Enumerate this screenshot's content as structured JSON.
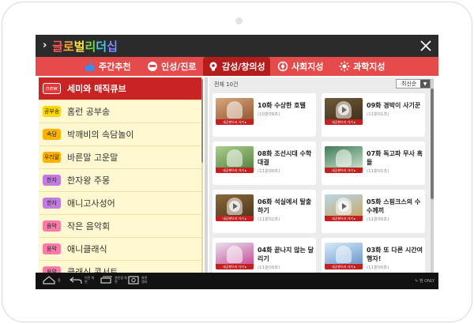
{
  "app": {
    "title_chars": [
      {
        "ch": "글",
        "color": "#ff5a5a"
      },
      {
        "ch": "로",
        "color": "#ffa53a"
      },
      {
        "ch": "벌",
        "color": "#ffe14a"
      },
      {
        "ch": "리",
        "color": "#7ad94a"
      },
      {
        "ch": "더",
        "color": "#4ac6e8"
      },
      {
        "ch": "십",
        "color": "#7a8cff"
      }
    ],
    "title": "글로벌리더십"
  },
  "tabs": [
    {
      "label": "주간추천",
      "icon": "thumbs-up-icon",
      "active": false
    },
    {
      "label": "인성/진로",
      "icon": "emoji-face-icon",
      "active": false
    },
    {
      "label": "감성/창의성",
      "icon": "lightbulb-icon",
      "active": true
    },
    {
      "label": "사회지성",
      "icon": "globe-icon",
      "active": false
    },
    {
      "label": "과학지성",
      "icon": "atom-icon",
      "active": false
    }
  ],
  "categories": [
    {
      "badge": "new",
      "badge_color": "#e23a3a",
      "label": "세미와 매직큐브",
      "active": true
    },
    {
      "badge": "공부송",
      "badge_color": "#ffd800",
      "label": "홈런 공부송",
      "active": false
    },
    {
      "badge": "속담",
      "badge_color": "#ffb300",
      "label": "박깨비의 속담놀이",
      "active": false
    },
    {
      "badge": "우리말",
      "badge_color": "#ffb300",
      "label": "바른말 고운말",
      "active": false
    },
    {
      "badge": "한자",
      "badge_color": "#c27be0",
      "label": "한자왕 주몽",
      "active": false
    },
    {
      "badge": "한자",
      "badge_color": "#c27be0",
      "label": "애니고사성어",
      "active": false
    },
    {
      "badge": "음악",
      "badge_color": "#ff7aa8",
      "label": "작은 음악회",
      "active": false
    },
    {
      "badge": "음악",
      "badge_color": "#ff7aa8",
      "label": "애니클래식",
      "active": false
    },
    {
      "badge": "음악",
      "badge_color": "#ff7aa8",
      "label": "클래식 콘서트",
      "active": false
    }
  ],
  "list": {
    "count_label": "전체 10건",
    "sort_label": "최신순",
    "thumb_tag": "내공쌓으러 가기 ▸",
    "episodes": [
      {
        "title": "10화 수상한 호텔",
        "duration": "(10분09초)",
        "thumb_bg": "#d9a77a",
        "thumb_fg": "#8a4b2a",
        "play": false
      },
      {
        "title": "09화 경박이 사기꾼",
        "duration": "(11분01초)",
        "thumb_bg": "#6f5a3a",
        "thumb_fg": "#3a2a18",
        "play": true
      },
      {
        "title": "08화 조선시대 수학 대결",
        "duration": "(11분00초)",
        "thumb_bg": "#a9d08a",
        "thumb_fg": "#4d7a3a",
        "play": false
      },
      {
        "title": "07화 독고파 무사 혹 돌",
        "duration": "(11분01초)",
        "thumb_bg": "#3f7a55",
        "thumb_fg": "#d8f0d8",
        "play": false
      },
      {
        "title": "06화 석실에서 탈출하기",
        "duration": "(11분02초)",
        "thumb_bg": "#8a6a3a",
        "thumb_fg": "#4a3218",
        "play": true
      },
      {
        "title": "05화 스핑크스의 수수께끼",
        "duration": "(11분00초)",
        "thumb_bg": "#b8d8e8",
        "thumb_fg": "#c9a25a",
        "play": true
      },
      {
        "title": "04화 끝나지 않는 달리기",
        "duration": "(11분00초)",
        "thumb_bg": "#e8e0f0",
        "thumb_fg": "#c63a8a",
        "play": false
      },
      {
        "title": "03화 또 다른 시간여행자!",
        "duration": "(11분00초)",
        "thumb_bg": "#d8ecf8",
        "thumb_fg": "#5a8ac8",
        "play": false
      }
    ]
  },
  "navbar": {
    "home_label": "홈",
    "back_label": "이전 화면",
    "recent_label": "열린앱 화면",
    "capture_label": "화면 캡쳐",
    "pen_only_label": "펜 ONLY"
  }
}
